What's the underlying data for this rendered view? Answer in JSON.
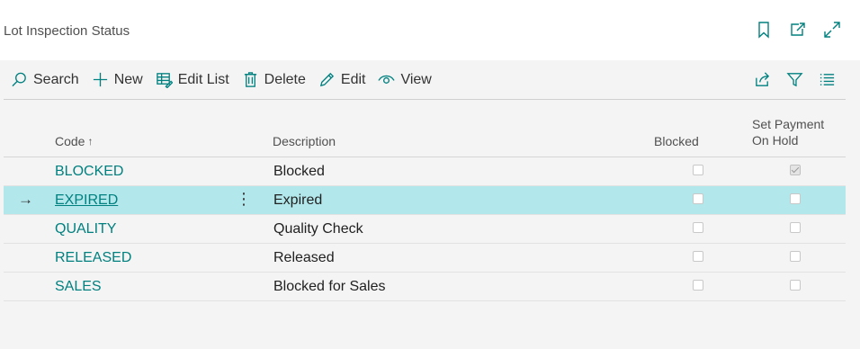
{
  "page": {
    "title": "Lot Inspection Status"
  },
  "toolbar": {
    "search_label": "Search",
    "new_label": "New",
    "edit_list_label": "Edit List",
    "delete_label": "Delete",
    "edit_label": "Edit",
    "view_label": "View"
  },
  "columns": {
    "code": "Code",
    "code_sort_indicator": "↑",
    "description": "Description",
    "blocked": "Blocked",
    "hold_line1": "Set Payment",
    "hold_line2": "On Hold"
  },
  "rows": [
    {
      "code": "BLOCKED",
      "description": "Blocked",
      "blocked": false,
      "set_payment_on_hold": true,
      "selected": false
    },
    {
      "code": "EXPIRED",
      "description": "Expired",
      "blocked": false,
      "set_payment_on_hold": false,
      "selected": true,
      "row_marker": "→",
      "more_glyph": "⋮"
    },
    {
      "code": "QUALITY",
      "description": "Quality Check",
      "blocked": false,
      "set_payment_on_hold": false,
      "selected": false
    },
    {
      "code": "RELEASED",
      "description": "Released",
      "blocked": false,
      "set_payment_on_hold": false,
      "selected": false
    },
    {
      "code": "SALES",
      "description": "Blocked for Sales",
      "blocked": false,
      "set_payment_on_hold": false,
      "selected": false
    }
  ],
  "colors": {
    "accent": "#00807f",
    "selected_row": "#b2e8ec"
  }
}
